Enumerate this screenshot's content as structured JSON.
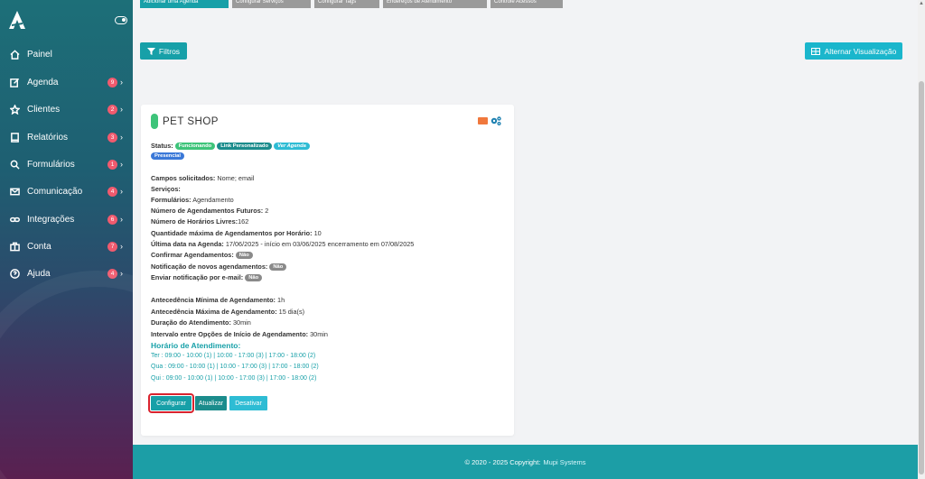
{
  "sidebar": {
    "items": [
      {
        "label": "Painel",
        "icon": "home-icon",
        "badge": ""
      },
      {
        "label": "Agenda",
        "icon": "edit-icon",
        "badge": "9"
      },
      {
        "label": "Clientes",
        "icon": "star-icon",
        "badge": "2"
      },
      {
        "label": "Relatórios",
        "icon": "book-icon",
        "badge": "3"
      },
      {
        "label": "Formulários",
        "icon": "search-icon",
        "badge": "1"
      },
      {
        "label": "Comunicação",
        "icon": "mail-icon",
        "badge": "4"
      },
      {
        "label": "Integrações",
        "icon": "link-icon",
        "badge": "6"
      },
      {
        "label": "Conta",
        "icon": "briefcase-icon",
        "badge": "7"
      },
      {
        "label": "Ajuda",
        "icon": "help-icon",
        "badge": "4"
      }
    ]
  },
  "tabs": [
    {
      "label": "Adicionar uma Agenda"
    },
    {
      "label": "Configurar Serviços"
    },
    {
      "label": "Configurar Tags"
    },
    {
      "label": "Endereços de Atendimento"
    },
    {
      "label": "Controle Acessos"
    }
  ],
  "toolbar": {
    "filter_label": "Filtros",
    "toggle_view_label": "Alternar Visualização"
  },
  "card": {
    "title": "PET SHOP",
    "status_label": "Status:",
    "status_badges": [
      "Funcionando",
      "Link Personalizado",
      "Ver Agenda",
      "Presencial"
    ],
    "fields": {
      "campos_label": "Campos solicitados:",
      "campos_value": " Nome; email",
      "servicos_label": "Serviços:",
      "formularios_label": "Formulários:",
      "formularios_value": " Agendamento",
      "futuros_label": "Número de Agendamentos Futuros:",
      "futuros_value": " 2",
      "livres_label": "Número de Horários Livres:",
      "livres_value": "162",
      "max_label": "Quantidade máxima de Agendamentos por Horário:",
      "max_value": " 10",
      "ultima_label": "Última data na Agenda:",
      "ultima_value": " 17/06/2025 - início em 03/06/2025 encerramento em 07/08/2025",
      "confirmar_label": "Confirmar Agendamentos:",
      "confirmar_value": "Não",
      "notif_label": "Notificação de novos agendamentos:",
      "notif_value": "Não",
      "email_label": "Enviar notificação por e-mail:",
      "email_value": "Não",
      "min_label": "Antecedência Mínima de Agendamento:",
      "min_value": " 1h",
      "maxant_label": "Antecedência Máxima de Agendamento:",
      "maxant_value": " 15 dia(s)",
      "dur_label": "Duração do Atendimento:",
      "dur_value": " 30min",
      "int_label": "Intervalo entre Opções de Início de Agendamento:",
      "int_value": " 30min"
    },
    "schedule_title": "Horário de Atendimento:",
    "schedule": [
      "Ter : 09:00 - 10:00 (1) | 10:00 - 17:00 (3) | 17:00 - 18:00 (2)",
      "Qua : 09:00 - 10:00 (1) | 10:00 - 17:00 (3) | 17:00 - 18:00 (2)",
      "Qui : 09:00 - 10:00 (1) | 10:00 - 17:00 (3) | 17:00 - 18:00 (2)"
    ],
    "buttons": {
      "configurar": "Configurar",
      "atualizar": "Atualizar",
      "desativar": "Desativar"
    }
  },
  "footer": {
    "copyright": "© 2020 - 2025 Copyright:",
    "company": "Mupi Systems"
  },
  "colors": {
    "primary": "#17a0a8",
    "highlight": "#d9232e",
    "badge": "#f05a6e"
  }
}
